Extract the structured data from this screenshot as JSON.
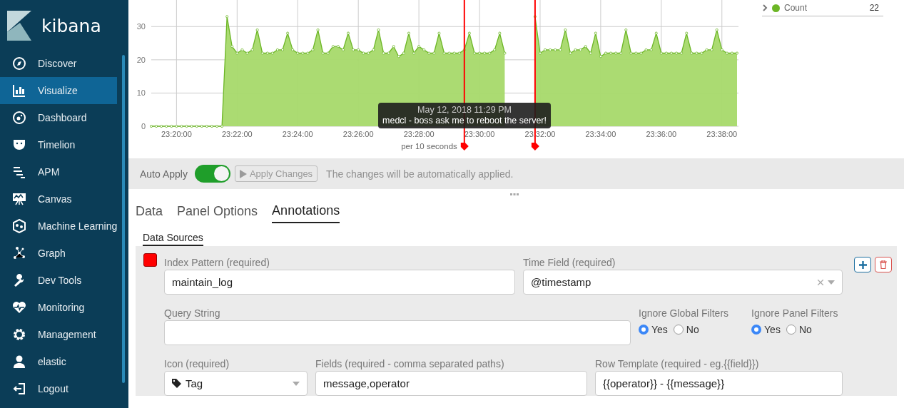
{
  "sidebar": {
    "logo": "kibana",
    "items": [
      {
        "label": "Discover",
        "selected": false
      },
      {
        "label": "Visualize",
        "selected": true
      },
      {
        "label": "Dashboard",
        "selected": false
      },
      {
        "label": "Timelion",
        "selected": false
      },
      {
        "label": "APM",
        "selected": false
      },
      {
        "label": "Canvas",
        "selected": false
      },
      {
        "label": "Machine Learning",
        "selected": false
      },
      {
        "label": "Graph",
        "selected": false
      },
      {
        "label": "Dev Tools",
        "selected": false
      },
      {
        "label": "Monitoring",
        "selected": false
      },
      {
        "label": "Management",
        "selected": false
      },
      {
        "label": "elastic",
        "selected": false
      },
      {
        "label": "Logout",
        "selected": false
      }
    ]
  },
  "chart": {
    "chart_data": {
      "type": "area",
      "xlabel": "per 10 seconds",
      "categories": [
        null,
        null,
        null,
        null,
        null,
        "23:20:00",
        null,
        null,
        null,
        null,
        null,
        null,
        null,
        null,
        null,
        null,
        null,
        "23:22:00",
        null,
        null,
        null,
        null,
        null,
        null,
        null,
        null,
        null,
        null,
        null,
        "23:24:00",
        null,
        null,
        null,
        null,
        null,
        null,
        null,
        null,
        null,
        null,
        null,
        "23:26:00",
        null,
        null,
        null,
        null,
        null,
        null,
        null,
        null,
        null,
        null,
        null,
        "23:28:00",
        null,
        null,
        null,
        null,
        null,
        null,
        null,
        null,
        null,
        null,
        null,
        "23:30:00",
        null,
        null,
        null,
        null,
        null,
        null,
        null,
        null,
        null,
        null,
        null,
        "23:32:00",
        null,
        null,
        null,
        null,
        null,
        null,
        null,
        null,
        null,
        null,
        null,
        "23:34:00",
        null,
        null,
        null,
        null,
        null,
        null,
        null,
        null,
        null,
        null,
        null,
        "23:36:00",
        null,
        null,
        null,
        null,
        null,
        null,
        null,
        null,
        null,
        null,
        null,
        "23:38:00",
        null,
        null,
        null
      ],
      "series": [
        {
          "name": "Count",
          "color": "#6cb626",
          "values": [
            0,
            0,
            0,
            0,
            0,
            0,
            0,
            0,
            0,
            0,
            0,
            0,
            0,
            0,
            0,
            33,
            24,
            22,
            23,
            22,
            23,
            29,
            22,
            22,
            22,
            23,
            23,
            28,
            23,
            22,
            22,
            22,
            23,
            29,
            22,
            22,
            24,
            24,
            23,
            28,
            23,
            23,
            22,
            22,
            23,
            29,
            22,
            22,
            24,
            21,
            22,
            28,
            22,
            24,
            23,
            22,
            22,
            28,
            22,
            22,
            22,
            22,
            23,
            28,
            22,
            22,
            22,
            22,
            23,
            28,
            22,
            null,
            null,
            null,
            null,
            null,
            33,
            22,
            23,
            23,
            23,
            23,
            29,
            22,
            23,
            23,
            24,
            22,
            28,
            21,
            22,
            22,
            22,
            22,
            29,
            22,
            22,
            22,
            23,
            23,
            28,
            22,
            22,
            22,
            22,
            22,
            28,
            22,
            22,
            22,
            23,
            23,
            29,
            23,
            22,
            22,
            22
          ]
        }
      ],
      "ylim": [
        0,
        38
      ],
      "yticks": [
        0,
        10,
        20,
        30
      ],
      "grid": true
    },
    "markers": [
      {
        "kind": "tag"
      },
      {
        "kind": "tag"
      }
    ],
    "tooltip": {
      "title": "May 12, 2018 11:29 PM",
      "text": "medcl - boss ask me to reboot the server!"
    },
    "legend": [
      {
        "value": "22"
      }
    ]
  },
  "toolbar": {
    "auto_apply": {
      "label": "Auto Apply",
      "on": true
    },
    "apply_button": {
      "label": "Apply Changes",
      "disabled": true
    },
    "hint": "The changes will be automatically applied."
  },
  "tabs": [
    {
      "label": "Data",
      "selected": false
    },
    {
      "label": "Panel Options",
      "selected": false
    },
    {
      "label": "Annotations",
      "selected": true
    }
  ],
  "subtabs": [
    {
      "label": "Data Sources",
      "selected": true
    }
  ],
  "annotation": {
    "color": "#ff0000",
    "index_pattern": {
      "label": "Index Pattern (required)",
      "value": "maintain_log"
    },
    "time_field": {
      "label": "Time Field (required)",
      "value": "@timestamp"
    },
    "query_string": {
      "label": "Query String"
    },
    "ignore_global_filters": {
      "label": "Ignore Global Filters",
      "options": [
        {
          "label": "Yes",
          "selected": true
        },
        {
          "label": "No",
          "selected": false
        }
      ]
    },
    "ignore_panel_filters": {
      "label": "Ignore Panel Filters",
      "options": [
        {
          "label": "Yes",
          "selected": true
        },
        {
          "label": "No",
          "selected": false
        }
      ]
    },
    "icon": {
      "label": "Icon (required)",
      "value": "Tag"
    },
    "fields": {
      "label": "Fields (required - comma separated paths)",
      "value": "message,operator"
    },
    "row_template": {
      "label": "Row Template (required - eg.{{field}})",
      "value": "{{operator}} - {{message}}"
    }
  }
}
